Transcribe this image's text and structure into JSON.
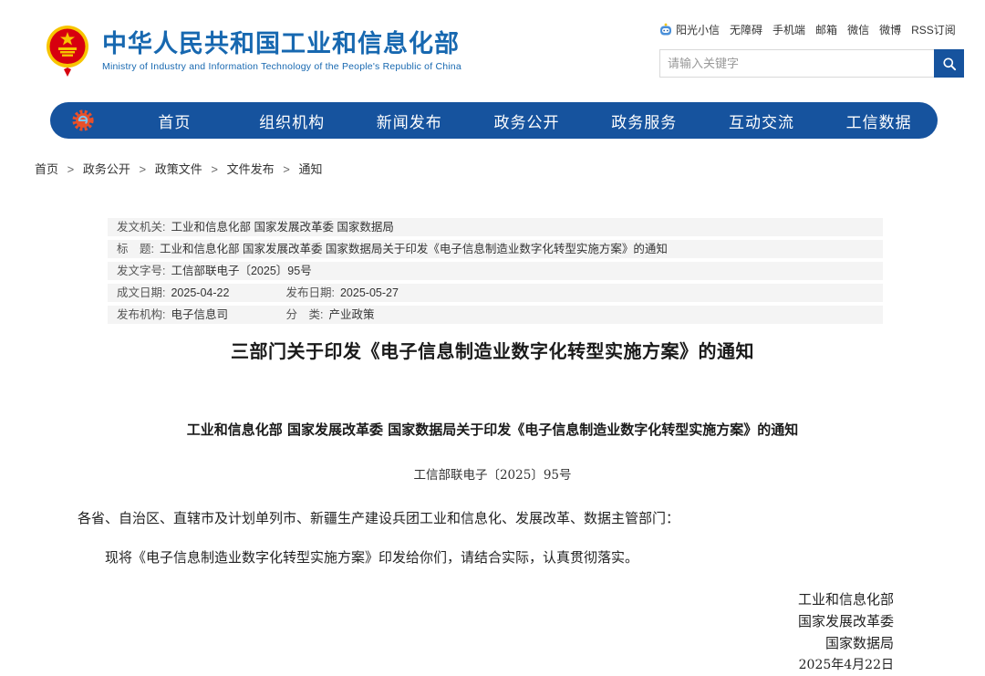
{
  "header": {
    "site_title": "中华人民共和国工业和信息化部",
    "site_subtitle": "Ministry of Industry and Information Technology of the People's Republic of China",
    "top_links": [
      "阳光小信",
      "无障碍",
      "手机端",
      "邮箱",
      "微信",
      "微博",
      "RSS订阅"
    ],
    "search": {
      "placeholder": "请输入关键字"
    }
  },
  "nav": {
    "items": [
      "首页",
      "组织机构",
      "新闻发布",
      "政务公开",
      "政务服务",
      "互动交流",
      "工信数据"
    ]
  },
  "breadcrumb": {
    "separator": ">",
    "items": [
      "首页",
      "政务公开",
      "政策文件",
      "文件发布",
      "通知"
    ]
  },
  "meta_table": {
    "rows": [
      {
        "cells": [
          {
            "label": "发文机关:",
            "value": "工业和信息化部 国家发展改革委 国家数据局"
          }
        ]
      },
      {
        "cells": [
          {
            "label": "标　题:",
            "value": "工业和信息化部 国家发展改革委 国家数据局关于印发《电子信息制造业数字化转型实施方案》的通知"
          }
        ]
      },
      {
        "cells": [
          {
            "label": "发文字号:",
            "value": "工信部联电子〔2025〕95号"
          }
        ]
      },
      {
        "cells": [
          {
            "label": "成文日期:",
            "value": "2025-04-22"
          },
          {
            "label": "发布日期:",
            "value": "2025-05-27"
          }
        ]
      },
      {
        "cells": [
          {
            "label": "发布机构:",
            "value": "电子信息司"
          },
          {
            "label": "分　类:",
            "value": "产业政策"
          }
        ]
      }
    ]
  },
  "article": {
    "title": "三部门关于印发《电子信息制造业数字化转型实施方案》的通知",
    "subtitle": "工业和信息化部 国家发展改革委 国家数据局关于印发《电子信息制造业数字化转型实施方案》的通知",
    "doc_number": "工信部联电子〔2025〕95号",
    "salutation": "各省、自治区、直辖市及计划单列市、新疆生产建设兵团工业和信息化、发展改革、数据主管部门：",
    "body": "现将《电子信息制造业数字化转型实施方案》印发给你们，请结合实际，认真贯彻落实。",
    "signatures": [
      "工业和信息化部",
      "国家发展改革委",
      "国家数据局"
    ],
    "date": "2025年4月22日"
  },
  "colors": {
    "nav_blue": "#16539e",
    "title_blue": "#1768b0",
    "emblem_red": "#d7000f",
    "emblem_gold": "#f7c500",
    "gear_orange": "#e8502a",
    "meta_row_bg": "#f4f4f4"
  }
}
